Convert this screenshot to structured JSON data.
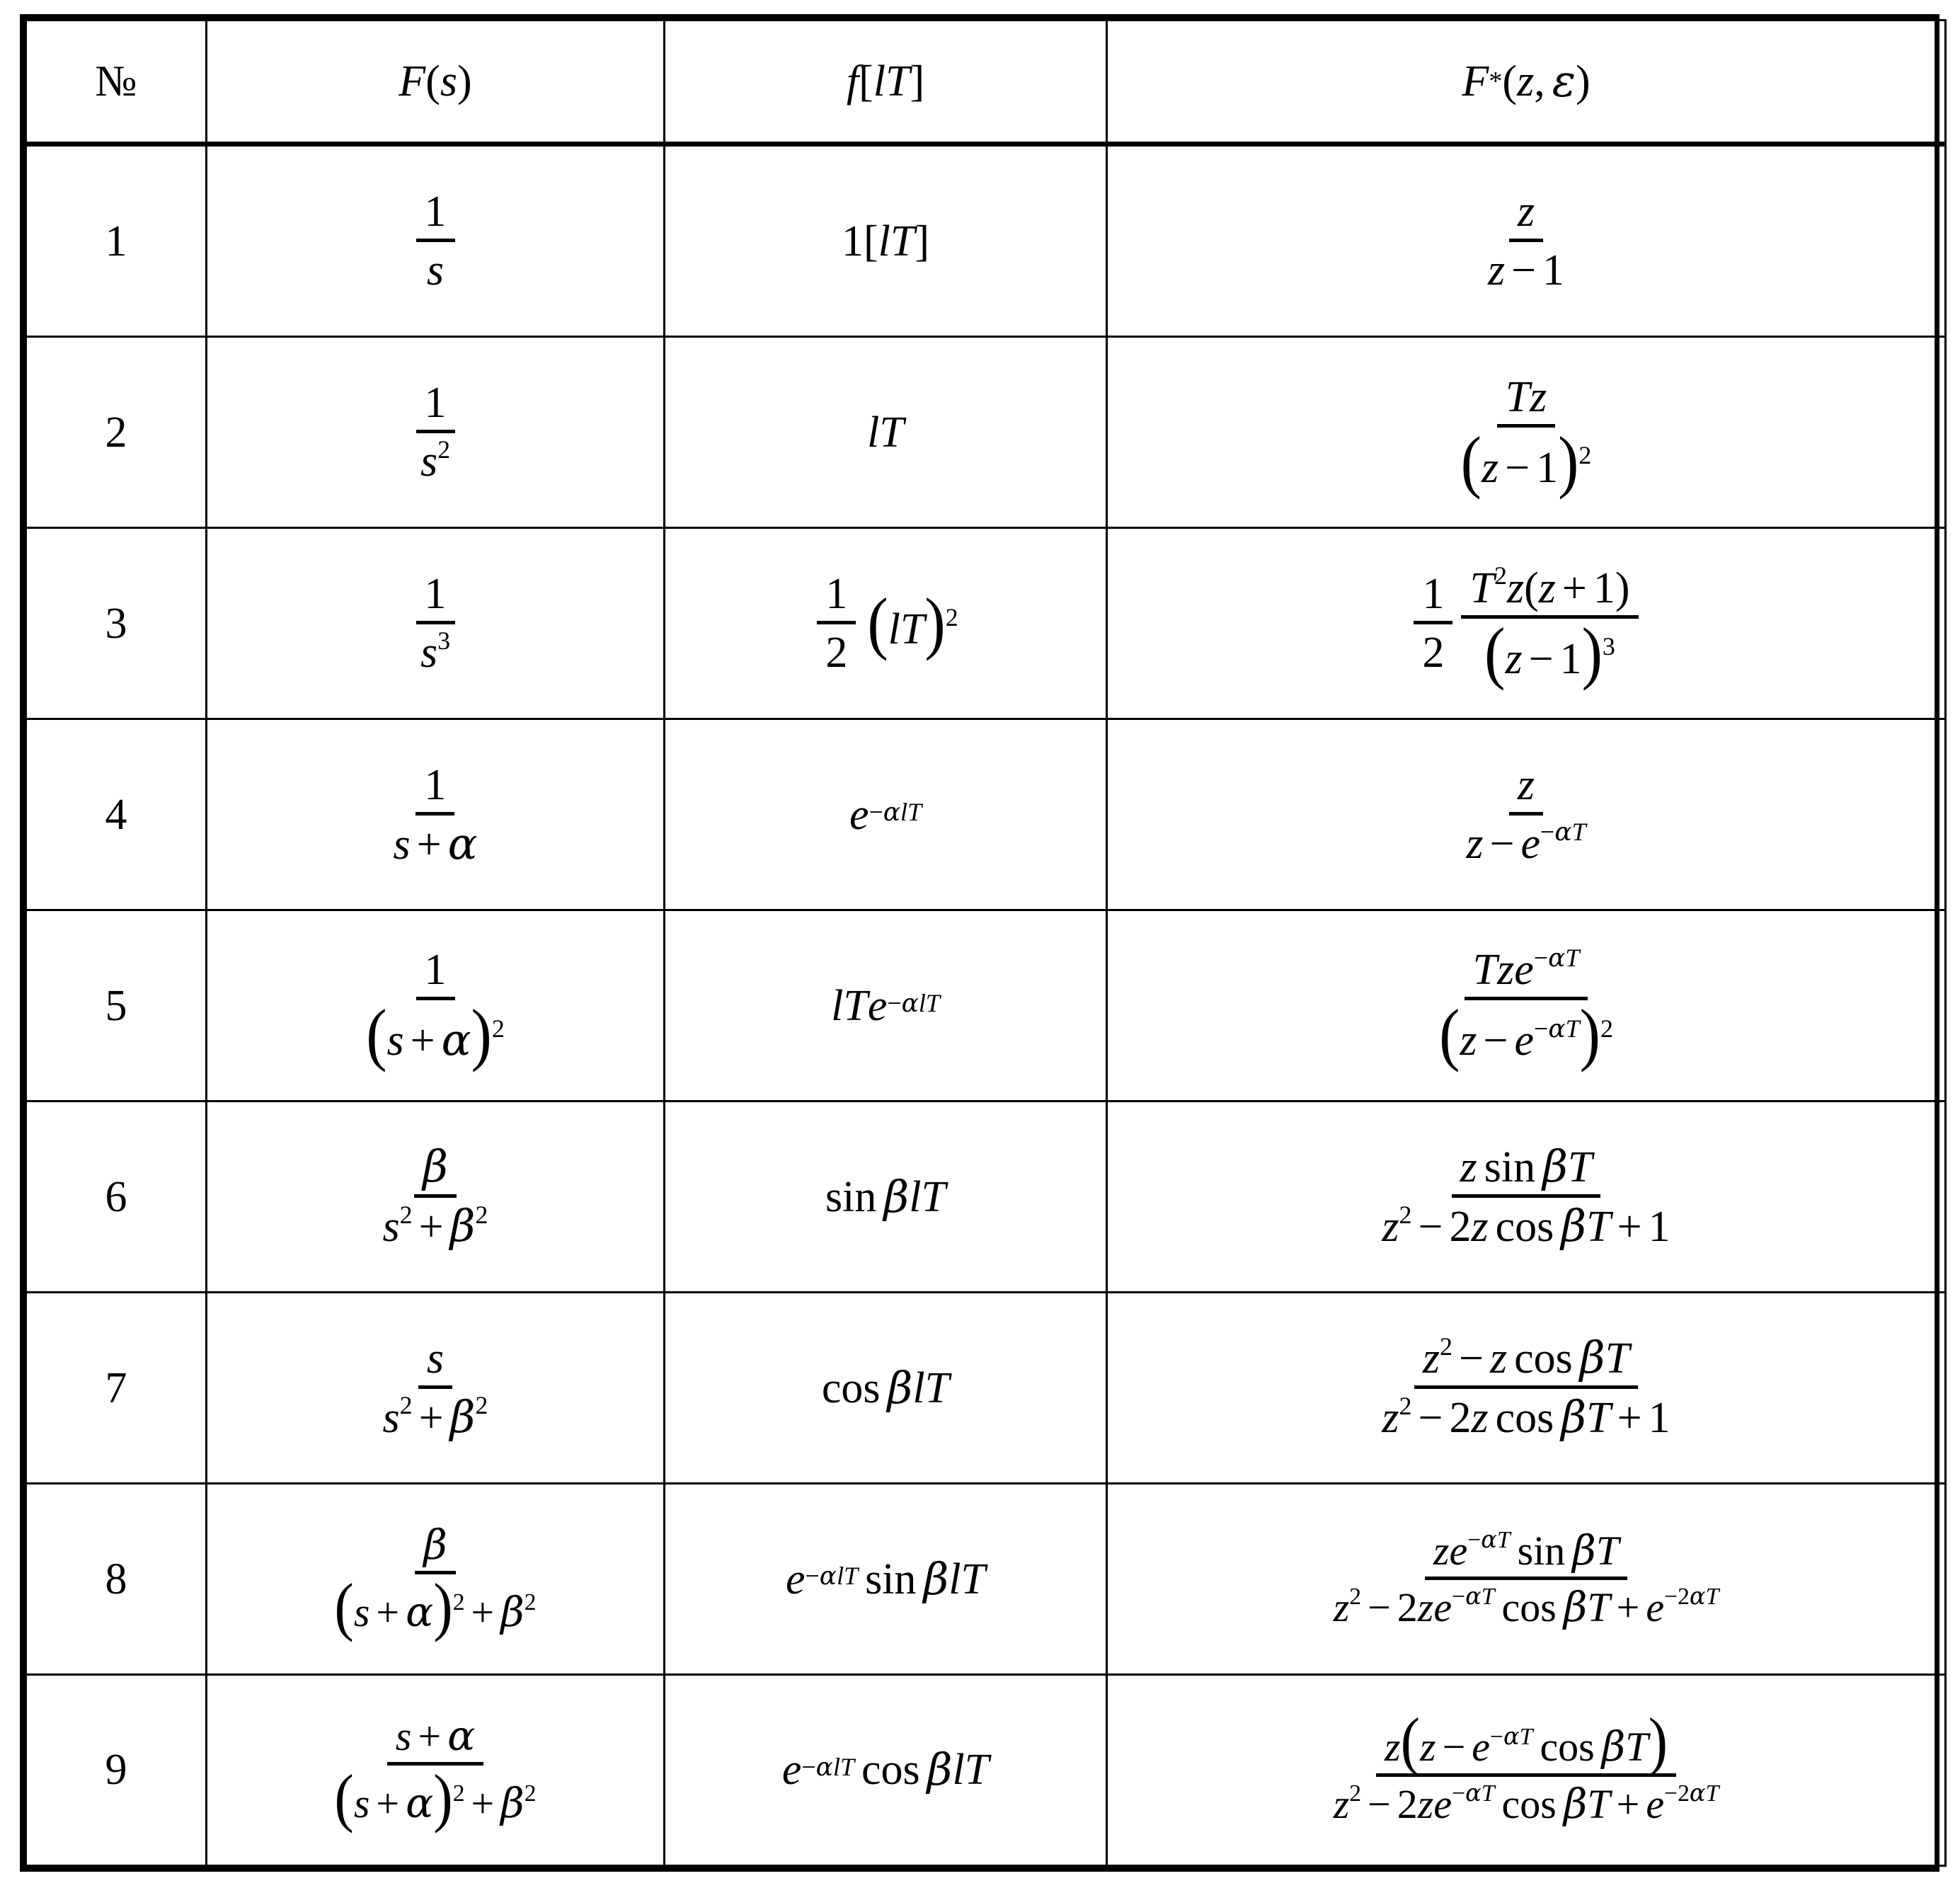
{
  "table": {
    "title": "Laplace, discrete-time and Z-transform correspondence table",
    "columns": [
      {
        "key": "num",
        "header": "№"
      },
      {
        "key": "laplace",
        "header": "F(s)"
      },
      {
        "key": "discrete",
        "header": "f[lT]"
      },
      {
        "key": "ztrans",
        "header": "F*(z, ε)"
      }
    ],
    "rows": [
      {
        "num": "1",
        "laplace": "1/s",
        "discrete": "1[lT]",
        "ztrans": "z/(z − 1)"
      },
      {
        "num": "2",
        "laplace": "1/s^2",
        "discrete": "lT",
        "ztrans": "Tz/(z − 1)^2"
      },
      {
        "num": "3",
        "laplace": "1/s^3",
        "discrete": "(1/2)(lT)^2",
        "ztrans": "(1/2) · T^2 z(z + 1)/(z − 1)^3"
      },
      {
        "num": "4",
        "laplace": "1/(s + α)",
        "discrete": "e^(−αlT)",
        "ztrans": "z/(z − e^(−αT))"
      },
      {
        "num": "5",
        "laplace": "1/(s + α)^2",
        "discrete": "lTe^(−αlT)",
        "ztrans": "Tze^(−αT)/(z − e^(−αT))^2"
      },
      {
        "num": "6",
        "laplace": "β/(s^2 + β^2)",
        "discrete": "sin βlT",
        "ztrans": "z sin βT/(z^2 − 2z cos βT + 1)"
      },
      {
        "num": "7",
        "laplace": "s/(s^2 + β^2)",
        "discrete": "cos βlT",
        "ztrans": "(z^2 − z cos βT)/(z^2 − 2z cos βT + 1)"
      },
      {
        "num": "8",
        "laplace": "β/((s + α)^2 + β^2)",
        "discrete": "e^(−αlT) sin βlT",
        "ztrans": "ze^(−αT) sin βT/(z^2 − 2ze^(−αT) cos βT + e^(−2αT))"
      },
      {
        "num": "9",
        "laplace": "(s + α)/((s + α)^2 + β^2)",
        "discrete": "e^(−αlT) cos βlT",
        "ztrans": "z(z − e^(−αT) cos βT)/(z^2 − 2ze^(−αT) cos βT + e^(−2αT))"
      }
    ],
    "symbols": {
      "numero": "№",
      "alpha": "α",
      "beta": "β",
      "epsilon": "ε",
      "minus": "−",
      "plus": "+",
      "asterisk": "*",
      "one": "1",
      "two": "2",
      "three": "3",
      "s": "s",
      "z": "z",
      "T": "T",
      "l": "l",
      "e": "e",
      "F": "F",
      "f": "f",
      "sin": "sin",
      "cos": "cos",
      "lbrack": "[",
      "rbrack": "]",
      "lparen": "(",
      "rparen": ")",
      "comma": ","
    },
    "colors": {
      "background": "#ffffff",
      "text": "#000000",
      "rule": "#000000"
    }
  }
}
